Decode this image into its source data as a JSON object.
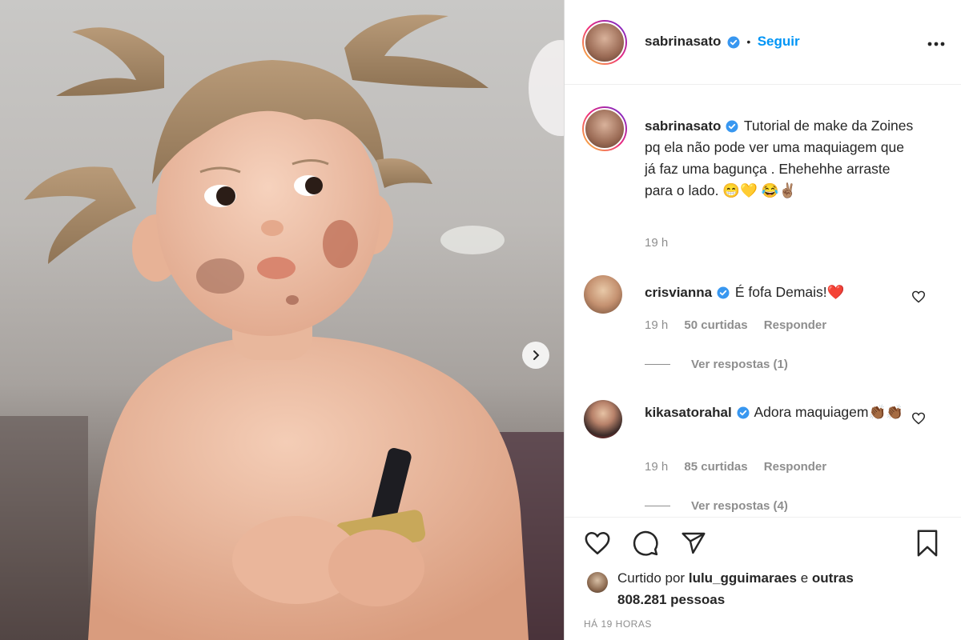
{
  "post": {
    "author": "sabrinasato",
    "separator": "•",
    "follow_label": "Seguir",
    "more_icon": "more-horizontal-icon",
    "verified_color": "#3897f0",
    "accent_color": "#0095f6"
  },
  "caption": {
    "username": "sabrinasato",
    "text": "Tutorial de make da Zoines pq ela não pode ver uma maquiagem que já faz uma bagunça . Ehehehhe arraste para o lado. 😁💛 😂✌🏽",
    "time": "19 h"
  },
  "comments": [
    {
      "username": "crisvianna",
      "text": "É fofa Demais!❤️",
      "time": "19 h",
      "likes": "50 curtidas",
      "reply_label": "Responder",
      "view_replies": "Ver respostas (1)"
    },
    {
      "username": "kikasatorahal",
      "text": "Adora maquiagem👏🏾👏🏾",
      "time": "19 h",
      "likes": "85 curtidas",
      "reply_label": "Responder",
      "view_replies": "Ver respostas (4)"
    }
  ],
  "footer": {
    "liked_prefix": "Curtido por",
    "liked_user": "lulu_gguimaraes",
    "liked_and": "e",
    "liked_others": "outras 808.281 pessoas",
    "timestamp": "HÁ 19 HORAS"
  },
  "icons": {
    "like": "heart-icon",
    "comment": "comment-icon",
    "share": "share-icon",
    "save": "bookmark-icon",
    "next": "chevron-right-icon"
  }
}
